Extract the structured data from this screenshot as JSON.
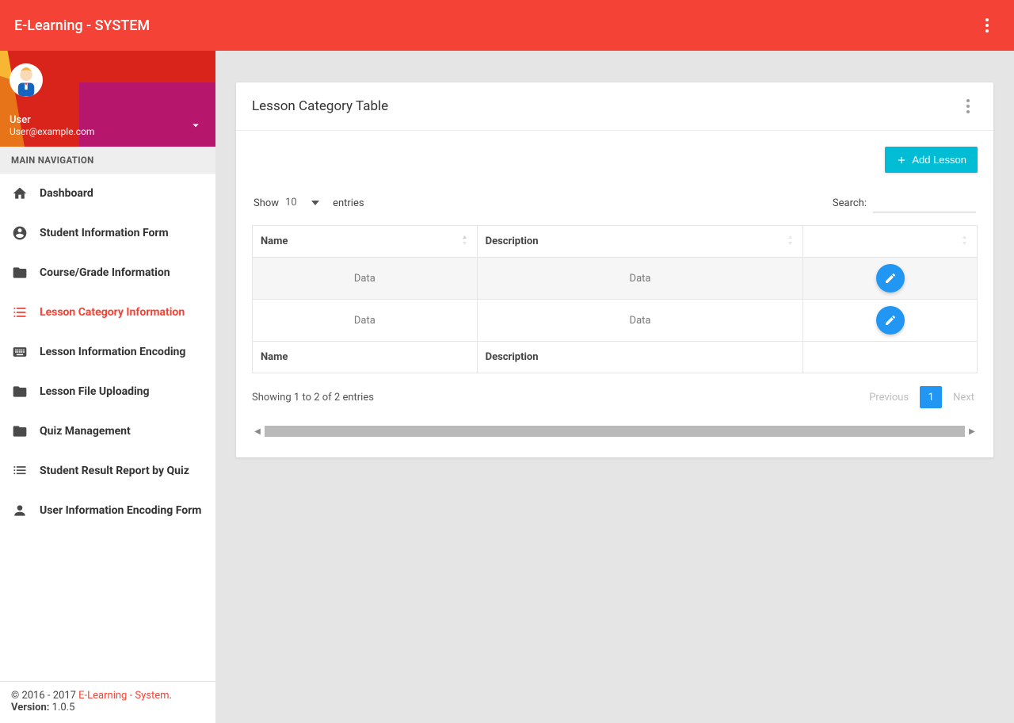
{
  "app": {
    "title": "E-Learning - SYSTEM"
  },
  "user": {
    "name": "User",
    "email": "User@example.com"
  },
  "sidebar": {
    "header": "MAIN NAVIGATION",
    "items": [
      {
        "label": "Dashboard",
        "icon": "home-icon",
        "active": false
      },
      {
        "label": "Student Information Form",
        "icon": "account-circle-icon",
        "active": false
      },
      {
        "label": "Course/Grade Information",
        "icon": "folder-icon",
        "active": false
      },
      {
        "label": "Lesson Category Information",
        "icon": "list-icon",
        "active": true
      },
      {
        "label": "Lesson Information Encoding",
        "icon": "keyboard-icon",
        "active": false
      },
      {
        "label": "Lesson File Uploading",
        "icon": "folder-icon",
        "active": false
      },
      {
        "label": "Quiz Management",
        "icon": "folder-icon",
        "active": false
      },
      {
        "label": "Student Result Report by Quiz",
        "icon": "list-alt-icon",
        "active": false
      },
      {
        "label": "User Information Encoding Form",
        "icon": "person-icon",
        "active": false
      }
    ]
  },
  "footer": {
    "copyright_prefix": "© 2016 - 2017 ",
    "brand": "E-Learning - System",
    "brand_suffix": ".",
    "version_label": "Version:",
    "version_value": "1.0.5"
  },
  "page": {
    "title": "Lesson Category Table",
    "add_button": "Add Lesson",
    "show_label": "Show",
    "entries_label": "entries",
    "page_size": "10",
    "search_label": "Search:",
    "columns": {
      "name": "Name",
      "description": "Description",
      "actions": ""
    },
    "rows": [
      {
        "name": "Data",
        "description": "Data"
      },
      {
        "name": "Data",
        "description": "Data"
      }
    ],
    "foot": {
      "name": "Name",
      "description": "Description"
    },
    "info": "Showing 1 to 2 of 2 entries",
    "pager": {
      "prev": "Previous",
      "next": "Next",
      "current": "1"
    }
  }
}
